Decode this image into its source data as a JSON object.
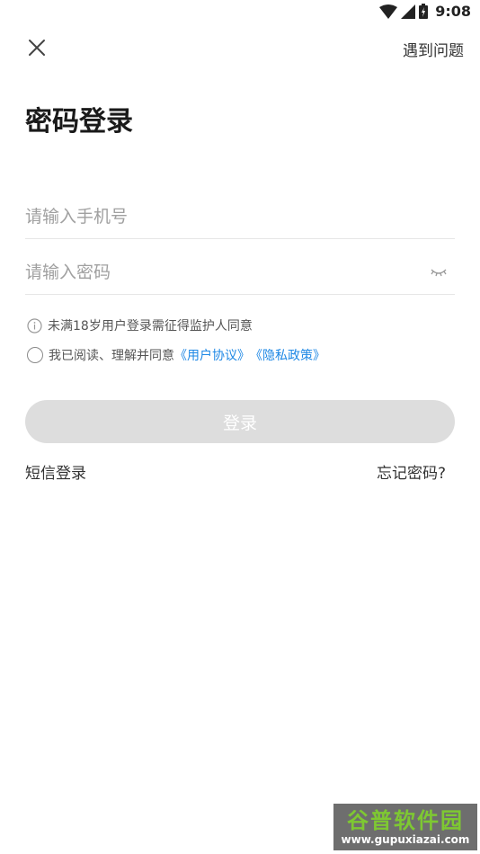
{
  "status_bar": {
    "time": "9:08",
    "icons": [
      "wifi-icon",
      "signal-icon",
      "battery-icon"
    ]
  },
  "header": {
    "close_icon": "close-icon",
    "help_label": "遇到问题"
  },
  "title": "密码登录",
  "form": {
    "phone_placeholder": "请输入手机号",
    "phone_value": "",
    "password_placeholder": "请输入密码",
    "password_value": "",
    "eye_icon": "eye-closed-icon"
  },
  "notice": {
    "icon": "info-icon",
    "text": "未满18岁用户登录需征得监护人同意"
  },
  "agreement": {
    "checked": false,
    "prefix": "我已阅读、理解并同意",
    "user_agreement": "《用户协议》",
    "privacy_policy": "《隐私政策》"
  },
  "login_button": "登录",
  "footer_links": {
    "sms_login": "短信登录",
    "forgot_password": "忘记密码?"
  },
  "watermark": {
    "title": "谷普软件园",
    "url": "www.gupuxiazai.com"
  },
  "colors": {
    "link": "#1e88e5",
    "button_disabled": "#dddddd",
    "watermark_green": "#7ec832"
  }
}
